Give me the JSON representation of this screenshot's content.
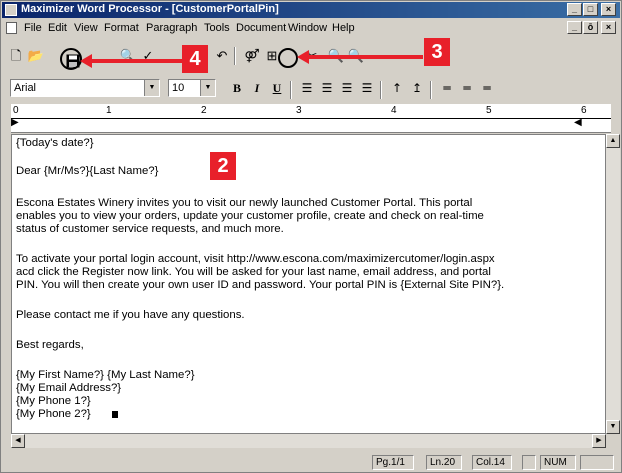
{
  "window": {
    "title": "Maximizer Word Processor - [CustomerPortalPin]"
  },
  "title_buttons": [
    "_",
    "□",
    "×"
  ],
  "doc_buttons": [
    "_",
    "ō",
    "×"
  ],
  "menu": [
    "File",
    "Edit",
    "View",
    "Format",
    "Paragraph",
    "Tools",
    "Document",
    "Window",
    "Help"
  ],
  "format": {
    "font": "Arial",
    "size": "10",
    "bold": "B",
    "italic": "I",
    "underline": "U"
  },
  "ruler": {
    "marks": [
      "0",
      "1",
      "2",
      "3",
      "4",
      "5",
      "6"
    ]
  },
  "document": {
    "lines": [
      "{Today's date?}",
      "",
      "Dear {Mr/Ms?}{Last Name?}",
      "",
      "Escona Estates Winery invites you to visit our newly launched Customer Portal. This portal",
      "enables you to view your orders, update your customer profile, create and check on real-time",
      "status of customer service requests, and much more.",
      "",
      "To activate your portal login account, visit http://www.escona.com/maximizercutomer/login.aspx",
      "acd click the Register now link. You will be asked for your last name, email address, and portal",
      "PIN. You will then create your own user ID and password. Your portal PIN is {External Site PIN?}.",
      "",
      "Please contact me if you have any questions.",
      "",
      "Best regards,",
      "",
      "{My First Name?} {My Last Name?}",
      "{My Email Address?}",
      "{My Phone 1?}",
      "{My Phone 2?}"
    ]
  },
  "status": {
    "page": "Pg.1/1",
    "line": "Ln.20",
    "col": "Col.14",
    "num": "NUM"
  },
  "callouts": {
    "a": "4",
    "b": "3",
    "c": "2"
  },
  "colors": {
    "callout": "#e8202a",
    "titlebar": "#0a246a"
  }
}
